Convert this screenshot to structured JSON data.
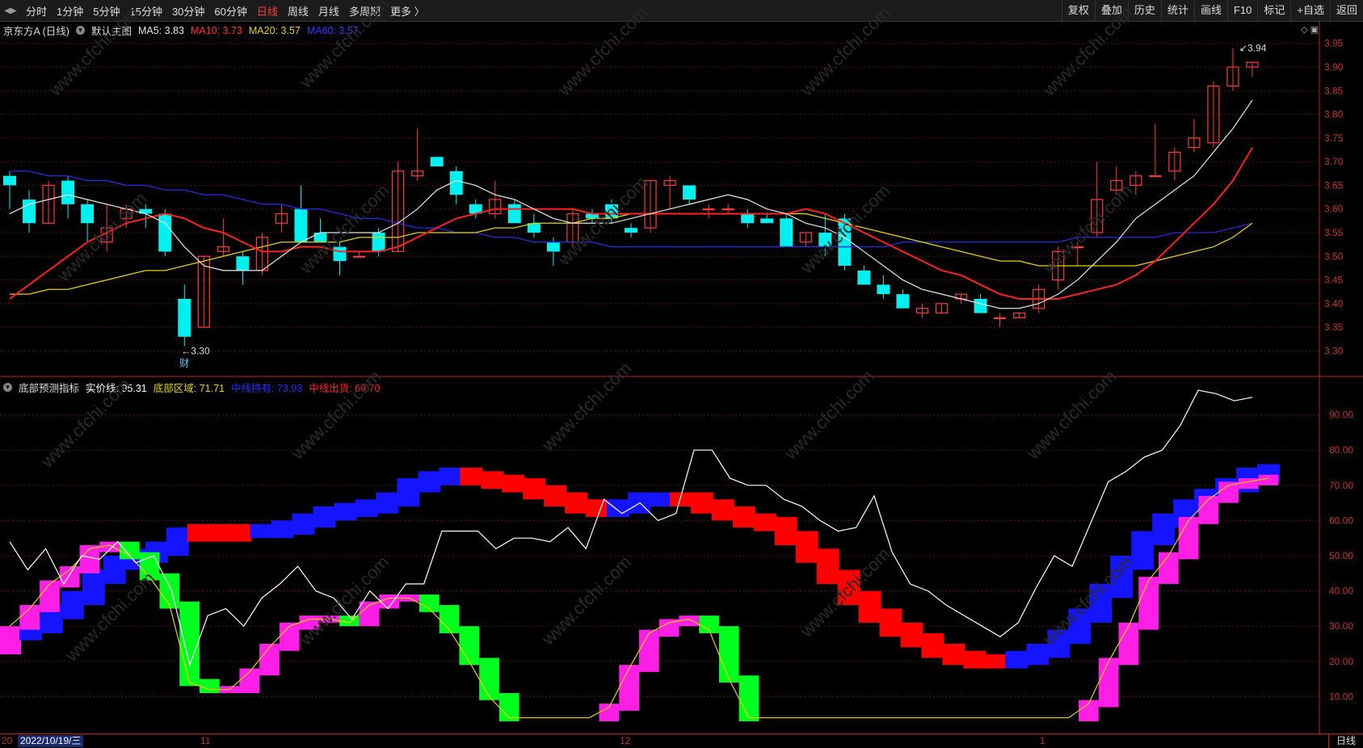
{
  "toolbar": {
    "periods": [
      "分时",
      "1分钟",
      "5分钟",
      "15分钟",
      "30分钟",
      "60分钟",
      "日线",
      "周线",
      "月线",
      "多周期",
      "更多 〉"
    ],
    "active_period": "日线",
    "tools": [
      "复权",
      "叠加",
      "历史",
      "统计",
      "画线",
      "F10",
      "标记",
      "+自选",
      "返回"
    ]
  },
  "main_header": {
    "title": "京东方A (日线)",
    "template": "默认主图",
    "ma5": "MA5: 3.83",
    "ma10": "MA10: 3.73",
    "ma20": "MA20: 3.57",
    "ma60": "MA60: 3.57"
  },
  "indicator_header": {
    "name": "底部预测指标",
    "price_line": "实价线: 95.31",
    "bottom_zone": "底部区域: 71.71",
    "mid_hold": "中线持有: 73.93",
    "mid_exit": "中线出货: 69.70"
  },
  "colors": {
    "up": "#ff3b3b",
    "down": "#00f0f0",
    "ma5": "#e6e6e6",
    "ma10": "#ff2020",
    "ma20": "#e6d200",
    "ma60": "#2a2ae6",
    "green": "#00ff1e",
    "magenta": "#ff1ee6",
    "blue": "#1414ff",
    "red": "#ff0000",
    "white": "#ffffff",
    "yellow": "#e6d200"
  },
  "chart_data": [
    {
      "type": "candlestick",
      "name": "京东方A (日线)",
      "ylim": [
        3.27,
        3.97
      ],
      "y_ticks": [
        "3.95",
        "3.90",
        "3.85",
        "3.80",
        "3.75",
        "3.70",
        "3.65",
        "3.60",
        "3.55",
        "3.50",
        "3.45",
        "3.40",
        "3.35",
        "3.30"
      ],
      "candles": [
        [
          3.67,
          3.68,
          3.6,
          3.65
        ],
        [
          3.62,
          3.64,
          3.55,
          3.57
        ],
        [
          3.57,
          3.66,
          3.57,
          3.65
        ],
        [
          3.66,
          3.67,
          3.58,
          3.61
        ],
        [
          3.61,
          3.62,
          3.53,
          3.57
        ],
        [
          3.53,
          3.61,
          3.51,
          3.56
        ],
        [
          3.58,
          3.61,
          3.56,
          3.6
        ],
        [
          3.6,
          3.61,
          3.56,
          3.59
        ],
        [
          3.59,
          3.6,
          3.5,
          3.51
        ],
        [
          3.41,
          3.44,
          3.31,
          3.33
        ],
        [
          3.35,
          3.5,
          3.35,
          3.5
        ],
        [
          3.51,
          3.58,
          3.5,
          3.52
        ],
        [
          3.5,
          3.51,
          3.44,
          3.47
        ],
        [
          3.47,
          3.55,
          3.46,
          3.54
        ],
        [
          3.57,
          3.61,
          3.55,
          3.59
        ],
        [
          3.6,
          3.65,
          3.53,
          3.53
        ],
        [
          3.55,
          3.58,
          3.53,
          3.53
        ],
        [
          3.52,
          3.53,
          3.46,
          3.49
        ],
        [
          3.5,
          3.51,
          3.5,
          3.5
        ],
        [
          3.55,
          3.56,
          3.5,
          3.51
        ],
        [
          3.51,
          3.7,
          3.51,
          3.68
        ],
        [
          3.67,
          3.77,
          3.66,
          3.68
        ],
        [
          3.71,
          3.71,
          3.69,
          3.69
        ],
        [
          3.68,
          3.69,
          3.61,
          3.63
        ],
        [
          3.61,
          3.62,
          3.58,
          3.59
        ],
        [
          3.59,
          3.66,
          3.58,
          3.62
        ],
        [
          3.61,
          3.62,
          3.58,
          3.57
        ],
        [
          3.57,
          3.59,
          3.54,
          3.55
        ],
        [
          3.53,
          3.54,
          3.48,
          3.51
        ],
        [
          3.53,
          3.6,
          3.52,
          3.59
        ],
        [
          3.59,
          3.6,
          3.57,
          3.58
        ],
        [
          3.61,
          3.62,
          3.57,
          3.58
        ],
        [
          3.56,
          3.57,
          3.54,
          3.55
        ],
        [
          3.56,
          3.66,
          3.55,
          3.66
        ],
        [
          3.65,
          3.67,
          3.6,
          3.66
        ],
        [
          3.65,
          3.65,
          3.61,
          3.62
        ],
        [
          3.6,
          3.61,
          3.58,
          3.6
        ],
        [
          3.6,
          3.61,
          3.59,
          3.6
        ],
        [
          3.59,
          3.6,
          3.56,
          3.57
        ],
        [
          3.58,
          3.59,
          3.57,
          3.57
        ],
        [
          3.58,
          3.59,
          3.52,
          3.52
        ],
        [
          3.53,
          3.55,
          3.52,
          3.55
        ],
        [
          3.55,
          3.59,
          3.5,
          3.52
        ],
        [
          3.58,
          3.59,
          3.47,
          3.48
        ],
        [
          3.47,
          3.48,
          3.44,
          3.44
        ],
        [
          3.44,
          3.46,
          3.41,
          3.42
        ],
        [
          3.42,
          3.43,
          3.39,
          3.39
        ],
        [
          3.38,
          3.4,
          3.37,
          3.39
        ],
        [
          3.38,
          3.4,
          3.38,
          3.4
        ],
        [
          3.41,
          3.42,
          3.4,
          3.42
        ],
        [
          3.41,
          3.42,
          3.38,
          3.38
        ],
        [
          3.37,
          3.38,
          3.35,
          3.37
        ],
        [
          3.37,
          3.38,
          3.37,
          3.38
        ],
        [
          3.39,
          3.44,
          3.38,
          3.43
        ],
        [
          3.45,
          3.52,
          3.43,
          3.51
        ],
        [
          3.52,
          3.53,
          3.48,
          3.52
        ],
        [
          3.55,
          3.7,
          3.54,
          3.62
        ],
        [
          3.64,
          3.69,
          3.63,
          3.66
        ],
        [
          3.65,
          3.68,
          3.63,
          3.67
        ],
        [
          3.67,
          3.78,
          3.67,
          3.67
        ],
        [
          3.68,
          3.73,
          3.66,
          3.72
        ],
        [
          3.73,
          3.79,
          3.72,
          3.75
        ],
        [
          3.74,
          3.87,
          3.73,
          3.86
        ],
        [
          3.86,
          3.94,
          3.85,
          3.9
        ],
        [
          3.9,
          3.91,
          3.88,
          3.91
        ]
      ],
      "ma5": [
        3.59,
        3.61,
        3.62,
        3.63,
        3.62,
        3.61,
        3.6,
        3.59,
        3.57,
        3.52,
        3.48,
        3.47,
        3.47,
        3.47,
        3.5,
        3.53,
        3.55,
        3.55,
        3.55,
        3.55,
        3.57,
        3.6,
        3.64,
        3.66,
        3.65,
        3.63,
        3.62,
        3.6,
        3.58,
        3.57,
        3.57,
        3.57,
        3.58,
        3.59,
        3.6,
        3.61,
        3.62,
        3.63,
        3.62,
        3.6,
        3.59,
        3.57,
        3.56,
        3.54,
        3.51,
        3.48,
        3.45,
        3.43,
        3.42,
        3.41,
        3.4,
        3.39,
        3.39,
        3.4,
        3.42,
        3.45,
        3.49,
        3.53,
        3.58,
        3.61,
        3.64,
        3.67,
        3.72,
        3.77,
        3.83
      ],
      "ma10": [
        3.41,
        3.44,
        3.47,
        3.5,
        3.53,
        3.55,
        3.57,
        3.58,
        3.59,
        3.58,
        3.56,
        3.55,
        3.53,
        3.51,
        3.51,
        3.52,
        3.52,
        3.51,
        3.51,
        3.51,
        3.52,
        3.54,
        3.56,
        3.58,
        3.59,
        3.6,
        3.6,
        3.6,
        3.6,
        3.6,
        3.59,
        3.59,
        3.59,
        3.59,
        3.59,
        3.59,
        3.59,
        3.59,
        3.59,
        3.59,
        3.59,
        3.6,
        3.59,
        3.57,
        3.55,
        3.53,
        3.51,
        3.49,
        3.47,
        3.46,
        3.44,
        3.42,
        3.41,
        3.41,
        3.41,
        3.42,
        3.43,
        3.44,
        3.46,
        3.49,
        3.53,
        3.57,
        3.61,
        3.66,
        3.73
      ],
      "ma20": [
        3.42,
        3.42,
        3.43,
        3.43,
        3.44,
        3.45,
        3.46,
        3.47,
        3.47,
        3.48,
        3.49,
        3.5,
        3.51,
        3.52,
        3.53,
        3.53,
        3.53,
        3.53,
        3.54,
        3.54,
        3.54,
        3.55,
        3.55,
        3.55,
        3.55,
        3.56,
        3.56,
        3.57,
        3.57,
        3.57,
        3.58,
        3.58,
        3.59,
        3.59,
        3.59,
        3.59,
        3.59,
        3.59,
        3.59,
        3.59,
        3.59,
        3.59,
        3.58,
        3.57,
        3.56,
        3.55,
        3.54,
        3.53,
        3.52,
        3.51,
        3.5,
        3.49,
        3.49,
        3.48,
        3.48,
        3.48,
        3.48,
        3.48,
        3.48,
        3.49,
        3.5,
        3.51,
        3.52,
        3.54,
        3.57
      ],
      "ma60": [
        3.68,
        3.68,
        3.67,
        3.67,
        3.66,
        3.66,
        3.65,
        3.65,
        3.64,
        3.64,
        3.63,
        3.63,
        3.62,
        3.61,
        3.61,
        3.6,
        3.6,
        3.59,
        3.58,
        3.58,
        3.57,
        3.56,
        3.56,
        3.55,
        3.55,
        3.54,
        3.54,
        3.53,
        3.53,
        3.53,
        3.53,
        3.52,
        3.52,
        3.52,
        3.52,
        3.52,
        3.52,
        3.52,
        3.52,
        3.52,
        3.52,
        3.52,
        3.52,
        3.52,
        3.52,
        3.52,
        3.53,
        3.53,
        3.53,
        3.53,
        3.53,
        3.53,
        3.53,
        3.53,
        3.53,
        3.54,
        3.54,
        3.54,
        3.54,
        3.54,
        3.55,
        3.55,
        3.55,
        3.56,
        3.57
      ],
      "annotations": {
        "high": "3.94",
        "low": "3.30",
        "low_marker": "财"
      }
    },
    {
      "type": "indicator",
      "name": "底部预测指标",
      "ylim": [
        0,
        100
      ],
      "y_ticks": [
        "90.00",
        "80.00",
        "70.00",
        "60.00",
        "50.00",
        "40.00",
        "30.00",
        "20.00",
        "10.00"
      ],
      "white_line": [
        54,
        46,
        52,
        42,
        50,
        49,
        54,
        48,
        50,
        40,
        19,
        33,
        35,
        30,
        38,
        42,
        47,
        40,
        38,
        32,
        40,
        35,
        42,
        42,
        57,
        57,
        57,
        52,
        55,
        55,
        54,
        58,
        52,
        66,
        62,
        65,
        60,
        62,
        80,
        80,
        72,
        70,
        70,
        66,
        64,
        60,
        57,
        58,
        67,
        51,
        42,
        40,
        36,
        33,
        30,
        27,
        31,
        41,
        50,
        47,
        59,
        71,
        74,
        78,
        80,
        87,
        97,
        96,
        94,
        95
      ],
      "yellow_line": [
        30,
        35,
        42,
        46,
        52,
        53,
        50,
        44,
        36,
        14,
        12,
        12,
        17,
        24,
        30,
        32,
        32,
        31,
        36,
        38,
        38,
        35,
        29,
        20,
        10,
        4,
        4,
        4,
        4,
        4,
        7,
        18,
        28,
        31,
        32,
        29,
        15,
        4,
        4,
        4,
        4,
        4,
        4,
        4,
        4,
        4,
        4,
        4,
        4,
        4,
        4,
        4,
        4,
        4,
        8,
        20,
        30,
        43,
        50,
        60,
        66,
        70,
        71,
        72
      ],
      "trend": [
        28,
        30,
        34,
        38,
        44,
        48,
        50,
        52,
        56,
        57,
        56,
        57,
        57,
        58,
        60,
        62,
        63,
        64,
        66,
        70,
        72,
        73,
        72,
        71,
        70,
        68,
        66,
        64,
        63,
        64,
        66,
        66,
        66,
        64,
        62,
        60,
        59,
        55,
        50,
        44,
        38,
        33,
        29,
        26,
        23,
        21,
        20,
        20,
        21,
        23,
        27,
        33,
        40,
        48,
        55,
        60,
        64,
        67,
        70,
        73,
        74
      ],
      "trend_colors": [
        "magenta",
        "blue",
        "blue",
        "blue",
        "blue",
        "blue",
        "blue",
        "blue",
        "blue",
        "red",
        "red",
        "red",
        "blue",
        "blue",
        "blue",
        "blue",
        "blue",
        "blue",
        "blue",
        "blue",
        "blue",
        "blue",
        "red",
        "red",
        "red",
        "red",
        "red",
        "red",
        "red",
        "blue",
        "blue",
        "blue",
        "red",
        "red",
        "red",
        "red",
        "red",
        "red",
        "red",
        "red",
        "red",
        "red",
        "red",
        "red",
        "red",
        "red",
        "red",
        "red",
        "blue",
        "blue",
        "blue",
        "blue",
        "blue",
        "blue",
        "blue",
        "blue",
        "blue",
        "blue",
        "blue",
        "blue",
        "blue"
      ]
    }
  ],
  "x_axis": {
    "cursor_date": "2022/10/19/三",
    "ticks": [
      "11",
      "12",
      "1"
    ],
    "period": "日线"
  },
  "watermark": "www.cfchi.com"
}
